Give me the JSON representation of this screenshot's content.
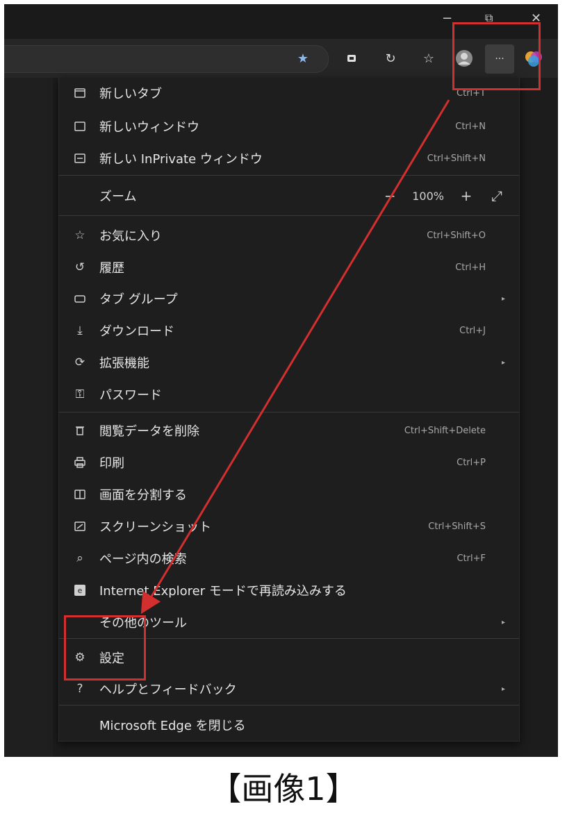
{
  "window": {
    "minimize": "−",
    "restore": "⧉",
    "close": "✕"
  },
  "toolbar": {
    "icons": [
      "favorite-star-icon",
      "extensions-icon",
      "refresh-icon",
      "favorites-icon",
      "profile-avatar",
      "more-menu-icon",
      "copilot-icon"
    ],
    "more_label": "···"
  },
  "menu": {
    "new_tab": {
      "label": "新しいタブ",
      "shortcut": "Ctrl+T"
    },
    "new_window": {
      "label": "新しいウィンドウ",
      "shortcut": "Ctrl+N"
    },
    "new_inprivate": {
      "label": "新しい InPrivate ウィンドウ",
      "shortcut": "Ctrl+Shift+N"
    },
    "zoom": {
      "label": "ズーム",
      "value": "100%",
      "minus": "−",
      "plus": "+",
      "fullscreen": "⤢"
    },
    "favorites": {
      "label": "お気に入り",
      "shortcut": "Ctrl+Shift+O"
    },
    "history": {
      "label": "履歴",
      "shortcut": "Ctrl+H"
    },
    "tab_groups": {
      "label": "タブ グループ"
    },
    "downloads": {
      "label": "ダウンロード",
      "shortcut": "Ctrl+J"
    },
    "extensions": {
      "label": "拡張機能"
    },
    "passwords": {
      "label": "パスワード"
    },
    "clear_data": {
      "label": "閲覧データを削除",
      "shortcut": "Ctrl+Shift+Delete"
    },
    "print": {
      "label": "印刷",
      "shortcut": "Ctrl+P"
    },
    "split_screen": {
      "label": "画面を分割する"
    },
    "screenshot": {
      "label": "スクリーンショット",
      "shortcut": "Ctrl+Shift+S"
    },
    "find": {
      "label": "ページ内の検索",
      "shortcut": "Ctrl+F"
    },
    "ie_mode": {
      "label": "Internet Explorer モードで再読み込みする"
    },
    "more_tools": {
      "label": "その他のツール"
    },
    "settings": {
      "label": "設定"
    },
    "help": {
      "label": "ヘルプとフィードバック"
    },
    "close_edge": {
      "label": "Microsoft Edge を閉じる"
    }
  },
  "caption": "【画像1】",
  "colors": {
    "annotation": "#d32f2f",
    "menu_bg": "#1e1e1e",
    "text": "#e6e6e6"
  }
}
